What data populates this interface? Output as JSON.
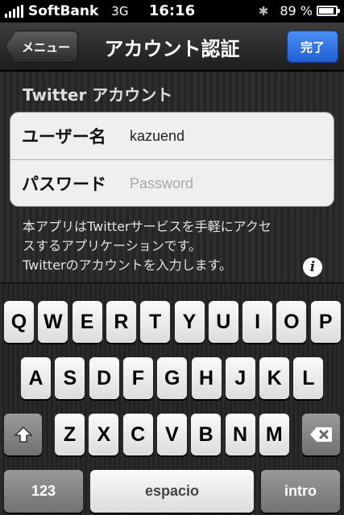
{
  "status_bar": {
    "carrier": "SoftBank",
    "network": "3G",
    "time": "16:16",
    "battery_percent": "89 %",
    "battery_level": 0.89
  },
  "nav": {
    "back_label": "メニュー",
    "title": "アカウント認証",
    "done_label": "完了"
  },
  "form": {
    "section_header": "Twitter アカウント",
    "username_label": "ユーザー名",
    "username_value": "kazuend",
    "password_label": "パスワード",
    "password_placeholder": "Password",
    "description_lines": [
      "本アプリはTwitterサービスを手軽にアクセ",
      "スするアプリケーションです。",
      "Twitterのアカウントを入力します。"
    ],
    "info_glyph": "i"
  },
  "keyboard": {
    "row1": [
      "Q",
      "W",
      "E",
      "R",
      "T",
      "Y",
      "U",
      "I",
      "O",
      "P"
    ],
    "row2": [
      "A",
      "S",
      "D",
      "F",
      "G",
      "H",
      "J",
      "K",
      "L"
    ],
    "row3": [
      "Z",
      "X",
      "C",
      "V",
      "B",
      "N",
      "M"
    ],
    "numbers_label": "123",
    "space_label": "espacio",
    "return_label": "intro",
    "shift_icon": "shift-arrow-icon",
    "delete_icon": "backspace-icon"
  }
}
